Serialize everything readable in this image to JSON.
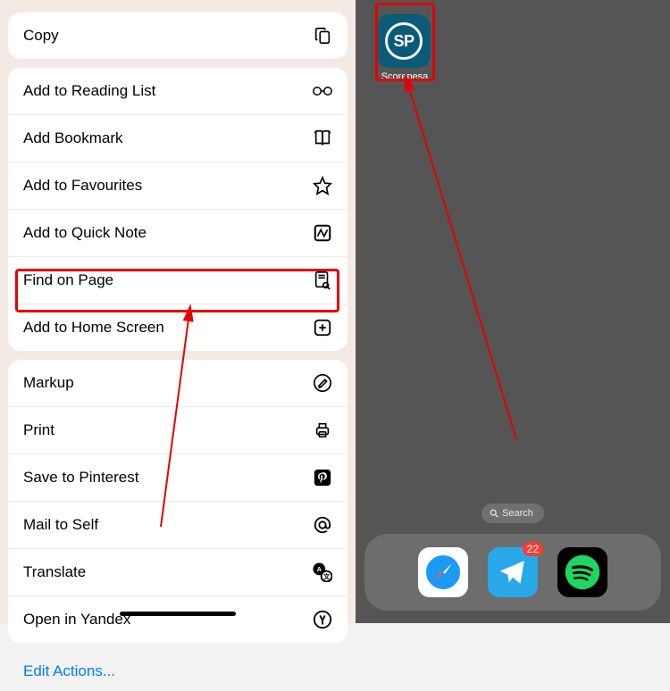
{
  "menu": {
    "group1": [
      {
        "label": "Copy",
        "icon": "copy-icon"
      }
    ],
    "group2": [
      {
        "label": "Add to Reading List",
        "icon": "glasses-icon"
      },
      {
        "label": "Add Bookmark",
        "icon": "book-icon"
      },
      {
        "label": "Add to Favourites",
        "icon": "star-icon"
      },
      {
        "label": "Add to Quick Note",
        "icon": "quicknote-icon"
      },
      {
        "label": "Find on Page",
        "icon": "find-icon"
      },
      {
        "label": "Add to Home Screen",
        "icon": "add-square-icon"
      }
    ],
    "group3": [
      {
        "label": "Markup",
        "icon": "markup-icon"
      },
      {
        "label": "Print",
        "icon": "print-icon"
      },
      {
        "label": "Save to Pinterest",
        "icon": "pinterest-icon"
      },
      {
        "label": "Mail to Self",
        "icon": "at-icon"
      },
      {
        "label": "Translate",
        "icon": "translate-icon"
      },
      {
        "label": "Open in Yandex",
        "icon": "yandex-icon"
      }
    ],
    "edit_actions": "Edit Actions..."
  },
  "home": {
    "app": {
      "badge": "SP",
      "label": "Scorepesa"
    },
    "search": "Search",
    "dock": {
      "telegram_badge": "22"
    }
  },
  "annotations": {
    "highlight_color": "#e60000"
  }
}
